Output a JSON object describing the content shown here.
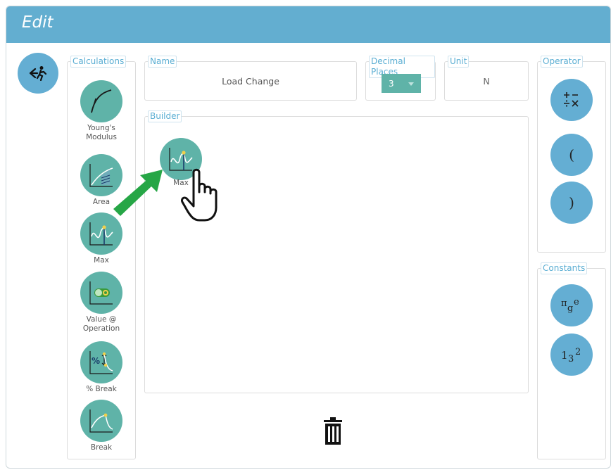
{
  "window": {
    "title": "Edit"
  },
  "exit_button": {
    "icon": "exit-run-icon"
  },
  "calculations": {
    "legend": "Calculations",
    "items": [
      {
        "label": "Young's Modulus",
        "icon": "youngs-modulus-icon"
      },
      {
        "label": "Area",
        "icon": "area-icon"
      },
      {
        "label": "Max",
        "icon": "max-icon"
      },
      {
        "label": "Value @ Operation",
        "icon": "value-at-operation-icon"
      },
      {
        "label": "% Break",
        "icon": "percent-break-icon"
      },
      {
        "label": "Break",
        "icon": "break-icon"
      }
    ]
  },
  "name": {
    "legend": "Name",
    "value": "Load Change"
  },
  "decimal_places": {
    "legend": "Decimal Places",
    "value": "3"
  },
  "unit": {
    "legend": "Unit",
    "value": "N"
  },
  "builder": {
    "legend": "Builder",
    "items": [
      {
        "label": "Max",
        "icon": "max-icon"
      }
    ]
  },
  "operator": {
    "legend": "Operator",
    "buttons": [
      {
        "label": "+-\n÷×",
        "icon": "operators-icon"
      },
      {
        "label": "("
      },
      {
        "label": ")"
      }
    ]
  },
  "constants": {
    "legend": "Constants",
    "buttons": [
      {
        "label": "πge",
        "icon": "constants-icon"
      },
      {
        "label": "1₃²",
        "icon": "numbers-icon"
      }
    ]
  },
  "colors": {
    "header": "#63aed0",
    "calc": "#5fb3a8",
    "operator": "#64aed3",
    "legend_text": "#5aaed3",
    "arrow": "#26a646"
  }
}
